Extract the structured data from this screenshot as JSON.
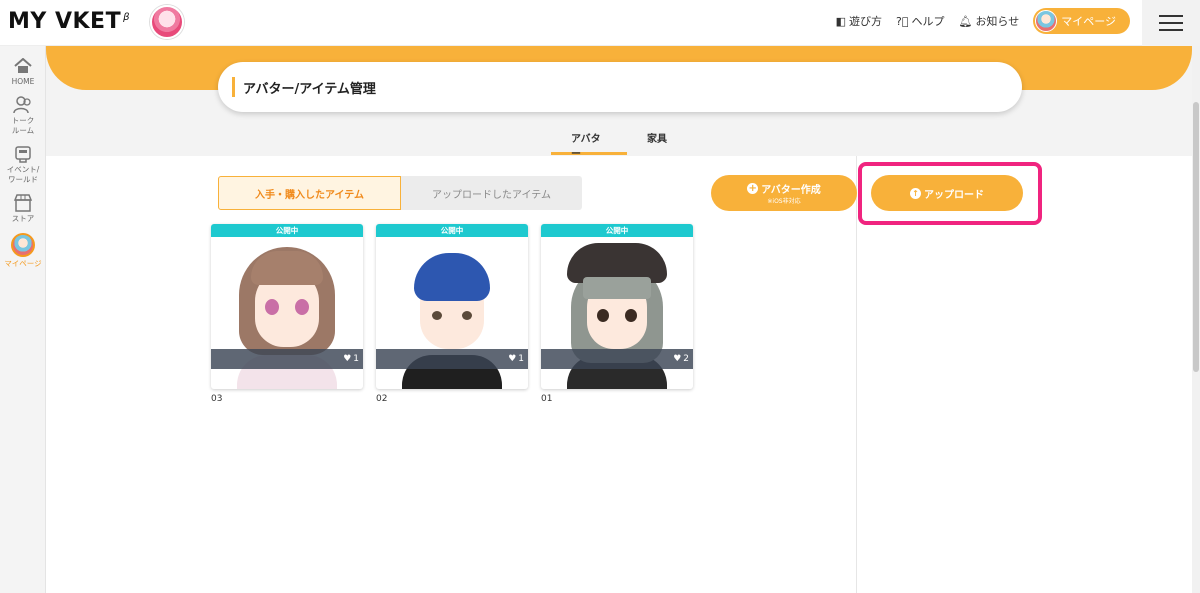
{
  "header": {
    "logo_text": "MY VKET",
    "logo_sup": "β",
    "nav": [
      {
        "icon": "book-icon",
        "label": "遊び方"
      },
      {
        "icon": "question-icon",
        "label": "ヘルプ"
      },
      {
        "icon": "bell-icon",
        "label": "お知らせ"
      }
    ],
    "mypage_label": "マイページ"
  },
  "sidebar": {
    "items": [
      {
        "icon": "home-icon",
        "label": "HOME"
      },
      {
        "icon": "people-icon",
        "label": "トーク\nルーム"
      },
      {
        "icon": "event-icon",
        "label": "イベント/\nワールド"
      },
      {
        "icon": "store-icon",
        "label": "ストア"
      },
      {
        "icon": "avatar-icon",
        "label": "マイページ"
      }
    ]
  },
  "page_title": "アバター/アイテム管理",
  "tabs": [
    {
      "label": "アバター",
      "active": true
    },
    {
      "label": "家具",
      "active": false
    }
  ],
  "filter": {
    "acquired": "入手・購入したアイテム",
    "uploaded": "アップロードしたアイテム"
  },
  "buttons": {
    "create_label": "アバター作成",
    "create_sub": "※iOS非対応",
    "upload_label": "アップロード"
  },
  "colors": {
    "accent": "#f8b13a",
    "status": "#1ec9cf",
    "highlight": "#f0247f"
  },
  "avatars": [
    {
      "status": "公開中",
      "likes": "1",
      "name": "03"
    },
    {
      "status": "公開中",
      "likes": "1",
      "name": "02"
    },
    {
      "status": "公開中",
      "likes": "2",
      "name": "01"
    }
  ]
}
